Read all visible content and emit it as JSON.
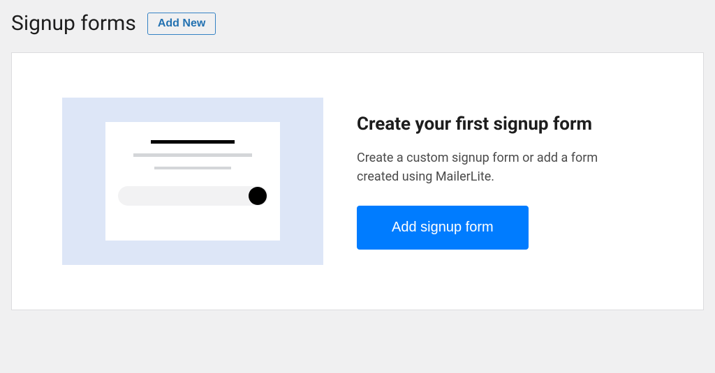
{
  "header": {
    "title": "Signup forms",
    "add_new_label": "Add New"
  },
  "empty_state": {
    "heading": "Create your first signup form",
    "description": "Create a custom signup form or add a form created using MailerLite.",
    "button_label": "Add signup form"
  }
}
